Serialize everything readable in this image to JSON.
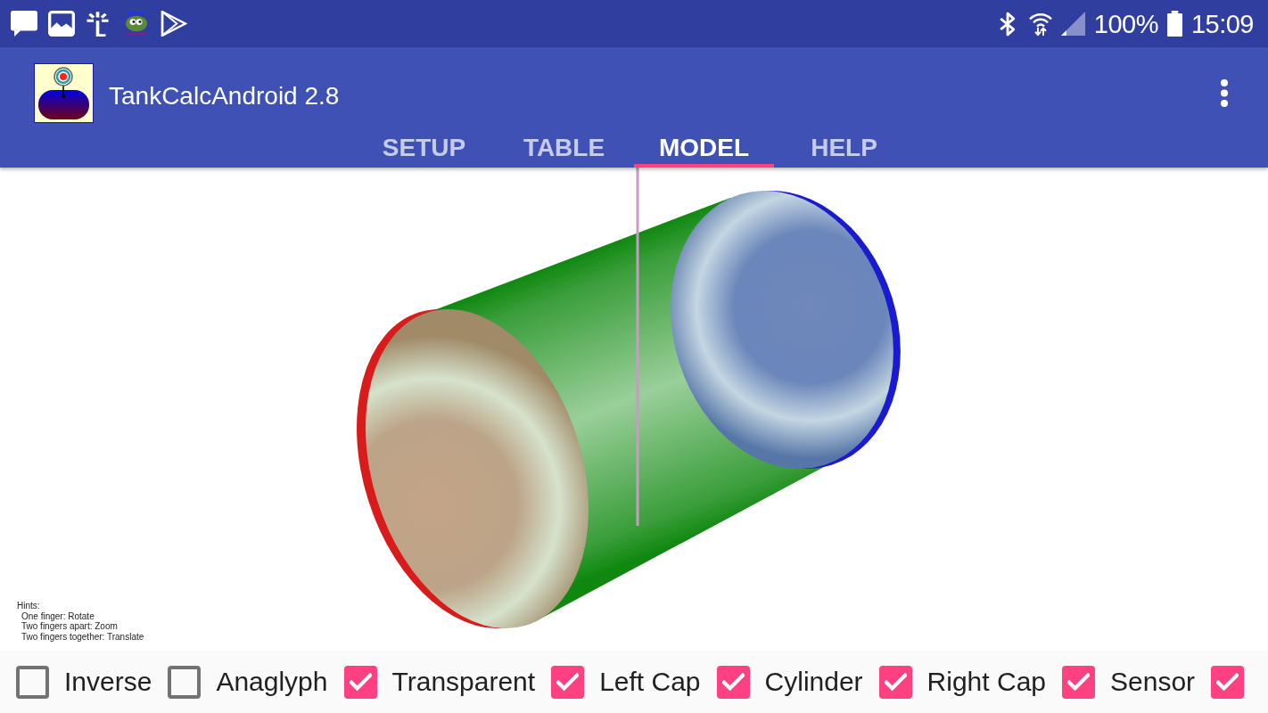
{
  "status_bar": {
    "battery": "100%",
    "time": "15:09"
  },
  "app_bar": {
    "title": "TankCalcAndroid 2.8"
  },
  "tabs": [
    {
      "label": "SETUP",
      "selected": false
    },
    {
      "label": "TABLE",
      "selected": false
    },
    {
      "label": "MODEL",
      "selected": true
    },
    {
      "label": "HELP",
      "selected": false
    }
  ],
  "model_view": {
    "hints": {
      "title": "Hints:",
      "lines": [
        "One finger: Rotate",
        "Two fingers apart: Zoom",
        "Two fingers together: Translate"
      ]
    }
  },
  "options": [
    {
      "label": "Inverse",
      "checked": false
    },
    {
      "label": "Anaglyph",
      "checked": false
    },
    {
      "label": "Transparent",
      "checked": true
    },
    {
      "label": "Left Cap",
      "checked": true
    },
    {
      "label": "Cylinder",
      "checked": true
    },
    {
      "label": "Right Cap",
      "checked": true
    },
    {
      "label": "Sensor",
      "checked": true
    },
    {
      "checked": true
    }
  ]
}
